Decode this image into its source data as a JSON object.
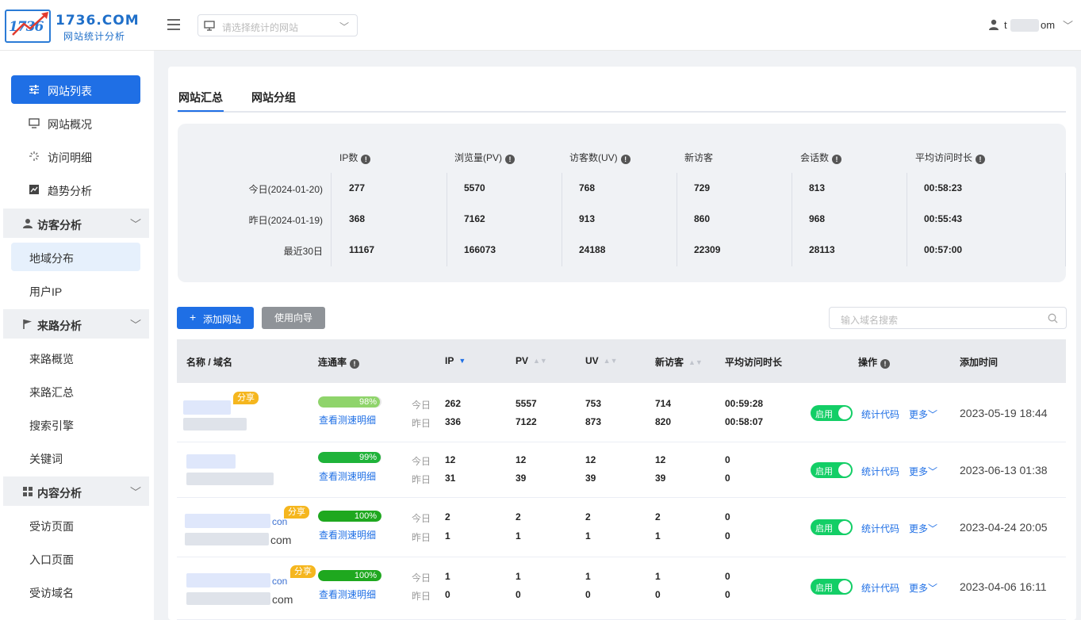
{
  "brand": {
    "name": "1736.COM",
    "sub": "网站统计分析",
    "mark": "1736"
  },
  "header": {
    "site_select_placeholder": "请选择统计的网站",
    "user_prefix": "t",
    "user_suffix": "om"
  },
  "sidebar": {
    "items": [
      {
        "label": "网站列表",
        "icon": "sliders-icon",
        "active": true
      },
      {
        "label": "网站概况",
        "icon": "monitor-icon"
      },
      {
        "label": "访问明细",
        "icon": "loading-icon"
      },
      {
        "label": "趋势分析",
        "icon": "chart-icon"
      }
    ],
    "groups": [
      {
        "label": "访客分析",
        "items": [
          "地域分布",
          "用户IP"
        ]
      },
      {
        "label": "来路分析",
        "items": [
          "来路概览",
          "来路汇总",
          "搜索引擎",
          "关键词"
        ]
      },
      {
        "label": "内容分析",
        "items": [
          "受访页面",
          "入口页面",
          "受访域名"
        ]
      }
    ]
  },
  "tabs": [
    "网站汇总",
    "网站分组"
  ],
  "summary": {
    "headers": [
      "IP数",
      "浏览量(PV)",
      "访客数(UV)",
      "新访客",
      "会话数",
      "平均访问时长"
    ],
    "rows": [
      {
        "label": "今日(2024-01-20)",
        "values": [
          "277",
          "5570",
          "768",
          "729",
          "813",
          "00:58:23"
        ]
      },
      {
        "label": "昨日(2024-01-19)",
        "values": [
          "368",
          "7162",
          "913",
          "860",
          "968",
          "00:55:43"
        ]
      },
      {
        "label": "最近30日",
        "values": [
          "11167",
          "166073",
          "24188",
          "22309",
          "28113",
          "00:57:00"
        ]
      }
    ]
  },
  "toolbar": {
    "add_label": "添加网站",
    "guide_label": "使用向导",
    "search_placeholder": "输入域名搜索"
  },
  "table": {
    "headers": [
      "名称 / 域名",
      "连通率",
      "IP",
      "PV",
      "UV",
      "新访客",
      "平均访问时长",
      "操作",
      "添加时间"
    ],
    "today_label": "今日",
    "yesterday_label": "昨日",
    "detail_link": "查看测速明细",
    "share_label": "分享",
    "toggle_label": "启用",
    "code_link": "统计代码",
    "more_link": "更多",
    "rows": [
      {
        "rate": "98%",
        "rate_value": 98,
        "rate_color": "#8fd46b",
        "today": [
          "262",
          "5557",
          "753",
          "714",
          "00:59:28"
        ],
        "yesterday": [
          "336",
          "7122",
          "873",
          "820",
          "00:58:07"
        ],
        "added": "2023-05-19 18:44",
        "domain_tail1": "",
        "domain_tail2": ""
      },
      {
        "rate": "99%",
        "rate_value": 99,
        "rate_color": "#1fb33a",
        "today": [
          "12",
          "12",
          "12",
          "12",
          "0"
        ],
        "yesterday": [
          "31",
          "39",
          "39",
          "39",
          "0"
        ],
        "added": "2023-06-13 01:38",
        "domain_tail1": "",
        "domain_tail2": ""
      },
      {
        "rate": "100%",
        "rate_value": 100,
        "rate_color": "#1fa81f",
        "today": [
          "2",
          "2",
          "2",
          "2",
          "0"
        ],
        "yesterday": [
          "1",
          "1",
          "1",
          "1",
          "0"
        ],
        "added": "2023-04-24 20:05",
        "domain_tail1": "con",
        "domain_tail2": "com"
      },
      {
        "rate": "100%",
        "rate_value": 100,
        "rate_color": "#1fa81f",
        "today": [
          "1",
          "1",
          "1",
          "1",
          "0"
        ],
        "yesterday": [
          "0",
          "0",
          "0",
          "0",
          "0"
        ],
        "added": "2023-04-06 16:11",
        "domain_tail1": "con",
        "domain_tail2": "com"
      }
    ]
  }
}
